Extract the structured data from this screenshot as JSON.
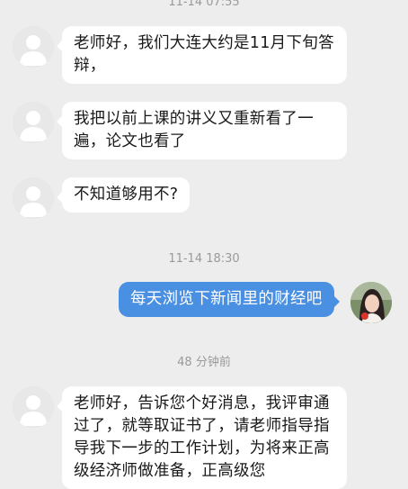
{
  "chat": {
    "timestamps": [
      "11-14 07:55",
      "11-14 18:30",
      "48 分钟前"
    ],
    "messages": [
      {
        "from": "contact",
        "text": "老师好，我们大连大约是11月下旬答辩，"
      },
      {
        "from": "contact",
        "text": "我把以前上课的讲义又重新看了一遍，论文也看了"
      },
      {
        "from": "contact",
        "text": "不知道够用不?"
      },
      {
        "from": "me",
        "text": "每天浏览下新闻里的财经吧"
      },
      {
        "from": "contact",
        "text": "老师好，告诉您个好消息，我评审通过了，就等取证书了，请老师指导指导我下一步的工作计划，为将来正高级经济师做准备，正高级您"
      }
    ]
  },
  "colors": {
    "background": "#ededed",
    "incoming_bubble": "#ffffff",
    "outgoing_bubble": "#4a90e2"
  },
  "icons": {
    "contact_avatar": "default-person-avatar-icon",
    "my_avatar": "user-photo-avatar"
  }
}
